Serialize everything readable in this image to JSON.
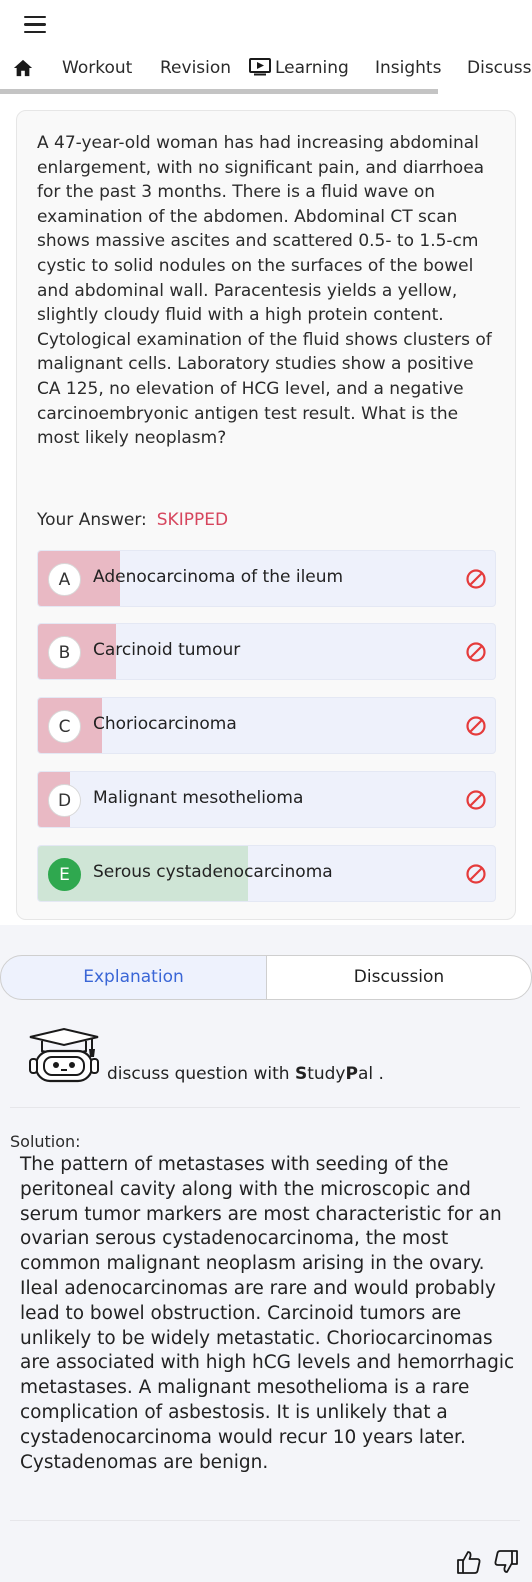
{
  "header": {
    "menu_icon": "hamburger-icon"
  },
  "tabs": [
    {
      "label": "",
      "icon": "home-icon"
    },
    {
      "label": "Workout"
    },
    {
      "label": "Revision"
    },
    {
      "label": "Learning",
      "icon": "play-screen-icon"
    },
    {
      "label": "Insights"
    },
    {
      "label": "Discuss"
    }
  ],
  "question": {
    "text": "A 47-year-old woman has had increasing abdominal enlargement, with no significant pain, and diarrhoea for the past 3 months. There is a fluid wave on examination of the abdomen. Abdominal CT scan shows massive ascites and scattered 0.5- to 1.5-cm cystic to solid nodules on the surfaces of the bowel and abdominal wall. Paracentesis yields a yellow, slightly cloudy fluid with a high protein content. Cytological examination of the fluid shows clusters of malignant cells. Laboratory studies show a positive CA 125, no elevation of HCG level, and a negative carcinoembryonic antigen test result. What is the most likely neoplasm?",
    "your_answer_label": "Your Answer:",
    "your_answer_value": "SKIPPED"
  },
  "options": [
    {
      "letter": "A",
      "text": "Adenocarcinoma of the ileum",
      "share": 0.18,
      "correct": false
    },
    {
      "letter": "B",
      "text": "Carcinoid tumour",
      "share": 0.17,
      "correct": false
    },
    {
      "letter": "C",
      "text": "Choriocarcinoma",
      "share": 0.14,
      "correct": false
    },
    {
      "letter": "D",
      "text": "Malignant mesothelioma",
      "share": 0.07,
      "correct": false
    },
    {
      "letter": "E",
      "text": "Serous cystadenocarcinoma",
      "share": 0.46,
      "correct": true
    }
  ],
  "colors": {
    "wrong_fill": "#e9b9c4",
    "correct_fill": "#cfe5d6",
    "correct_badge": "#2fa84f",
    "skipped": "#d6455d",
    "ban_icon": "#e53b3b",
    "active_tab": "#3a66d6"
  },
  "segments": {
    "explanation": "Explanation",
    "discussion": "Discussion"
  },
  "studypal": {
    "prefix": "discuss question with ",
    "s": "S",
    "tudy": "tudy",
    "p": "P",
    "al": "al ."
  },
  "solution": {
    "label": "Solution:",
    "text": "The pattern of metastases with seeding of the peritoneal cavity along with the microscopic and serum tumor markers are most characteristic for an ovarian serous cystadenocarcinoma, the most common malignant neoplasm arising in the ovary. Ileal adenocarcinomas are rare and would probably lead to bowel obstruction. Carcinoid tumors are unlikely to be widely metastatic. Choriocarcinomas are associated with high hCG levels and hemorrhagic metastases. A malignant mesothelioma is a rare complication of asbestosis. It is unlikely that a cystadenocarcinoma would recur 10 years later. Cystadenomas are benign."
  },
  "feedback": {
    "like_icon": "thumbs-up-icon",
    "dislike_icon": "thumbs-down-icon"
  }
}
